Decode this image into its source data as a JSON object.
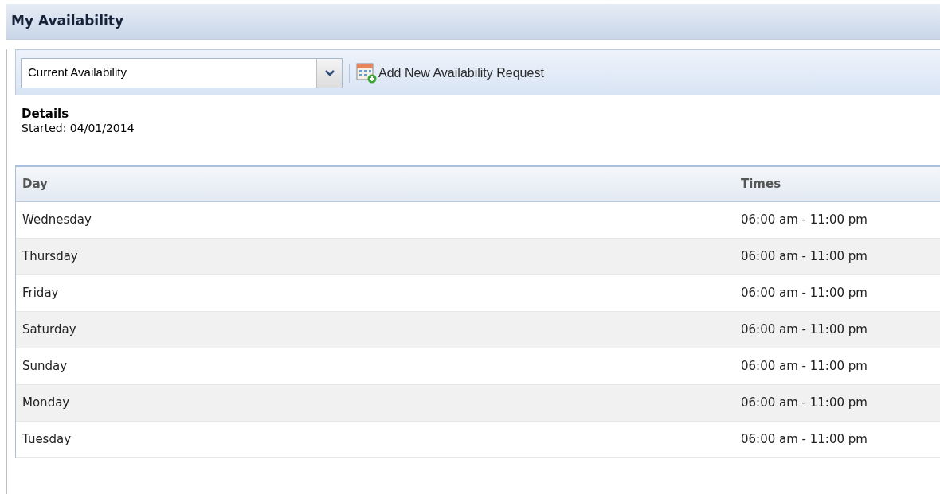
{
  "window": {
    "title": "My Availability"
  },
  "toolbar": {
    "dropdown": {
      "value": "Current Availability"
    },
    "add_button": {
      "label": "Add New Availability Request"
    }
  },
  "details": {
    "heading": "Details",
    "started": "Started: 04/01/2014"
  },
  "table": {
    "columns": [
      "Day",
      "Times"
    ],
    "rows": [
      {
        "day": "Wednesday",
        "times": "06:00 am - 11:00 pm"
      },
      {
        "day": "Thursday",
        "times": "06:00 am - 11:00 pm"
      },
      {
        "day": "Friday",
        "times": "06:00 am - 11:00 pm"
      },
      {
        "day": "Saturday",
        "times": "06:00 am - 11:00 pm"
      },
      {
        "day": "Sunday",
        "times": "06:00 am - 11:00 pm"
      },
      {
        "day": "Monday",
        "times": "06:00 am - 11:00 pm"
      },
      {
        "day": "Tuesday",
        "times": "06:00 am - 11:00 pm"
      }
    ]
  }
}
